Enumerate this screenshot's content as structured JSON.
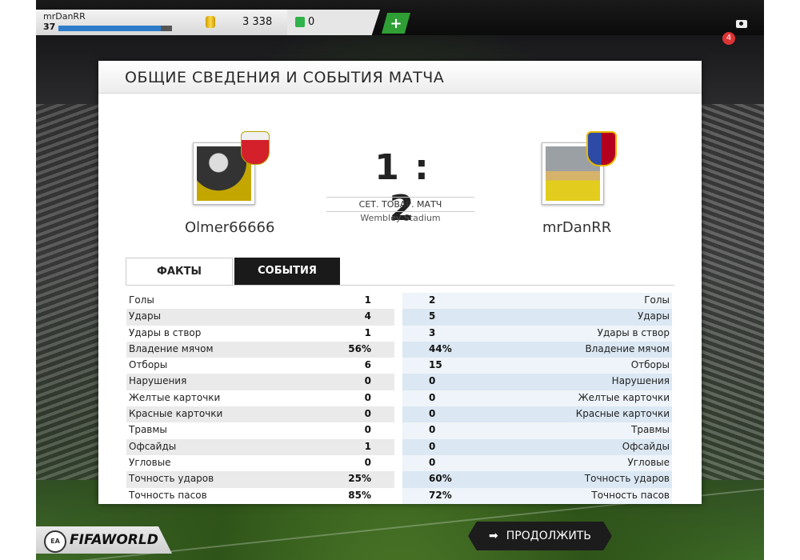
{
  "topbar": {
    "username": "mrDanRR",
    "level": "37",
    "xp_fraction": 0.9,
    "coins": "3 338",
    "points": "0",
    "add_label": "+",
    "notifications": "4"
  },
  "panel": {
    "title": "ОБЩИЕ СВЕДЕНИЯ И СОБЫТИЯ МАТЧА",
    "home_player": "Olmer66666",
    "away_player": "mrDanRR",
    "score": "1 : 2",
    "match_type": "СЕТ. ТОВАР. МАТЧ",
    "stadium": "Wembley Stadium",
    "tabs": [
      {
        "label": "ФАКТЫ"
      },
      {
        "label": "СОБЫТИЯ"
      }
    ]
  },
  "stats": [
    {
      "label": "Голы",
      "home": "1",
      "away": "2"
    },
    {
      "label": "Удары",
      "home": "4",
      "away": "5"
    },
    {
      "label": "Удары в створ",
      "home": "1",
      "away": "3"
    },
    {
      "label": "Владение мячом",
      "home": "56%",
      "away": "44%"
    },
    {
      "label": "Отборы",
      "home": "6",
      "away": "15"
    },
    {
      "label": "Нарушения",
      "home": "0",
      "away": "0"
    },
    {
      "label": "Желтые карточки",
      "home": "0",
      "away": "0"
    },
    {
      "label": "Красные карточки",
      "home": "0",
      "away": "0"
    },
    {
      "label": "Травмы",
      "home": "0",
      "away": "0"
    },
    {
      "label": "Офсайды",
      "home": "1",
      "away": "0"
    },
    {
      "label": "Угловые",
      "home": "0",
      "away": "0"
    },
    {
      "label": "Точность ударов",
      "home": "25%",
      "away": "60%"
    },
    {
      "label": "Точность пасов",
      "home": "85%",
      "away": "72%"
    }
  ],
  "bottom": {
    "continue_label": "ПРОДОЛЖИТЬ",
    "logo_text": "FIFAWORLD"
  }
}
